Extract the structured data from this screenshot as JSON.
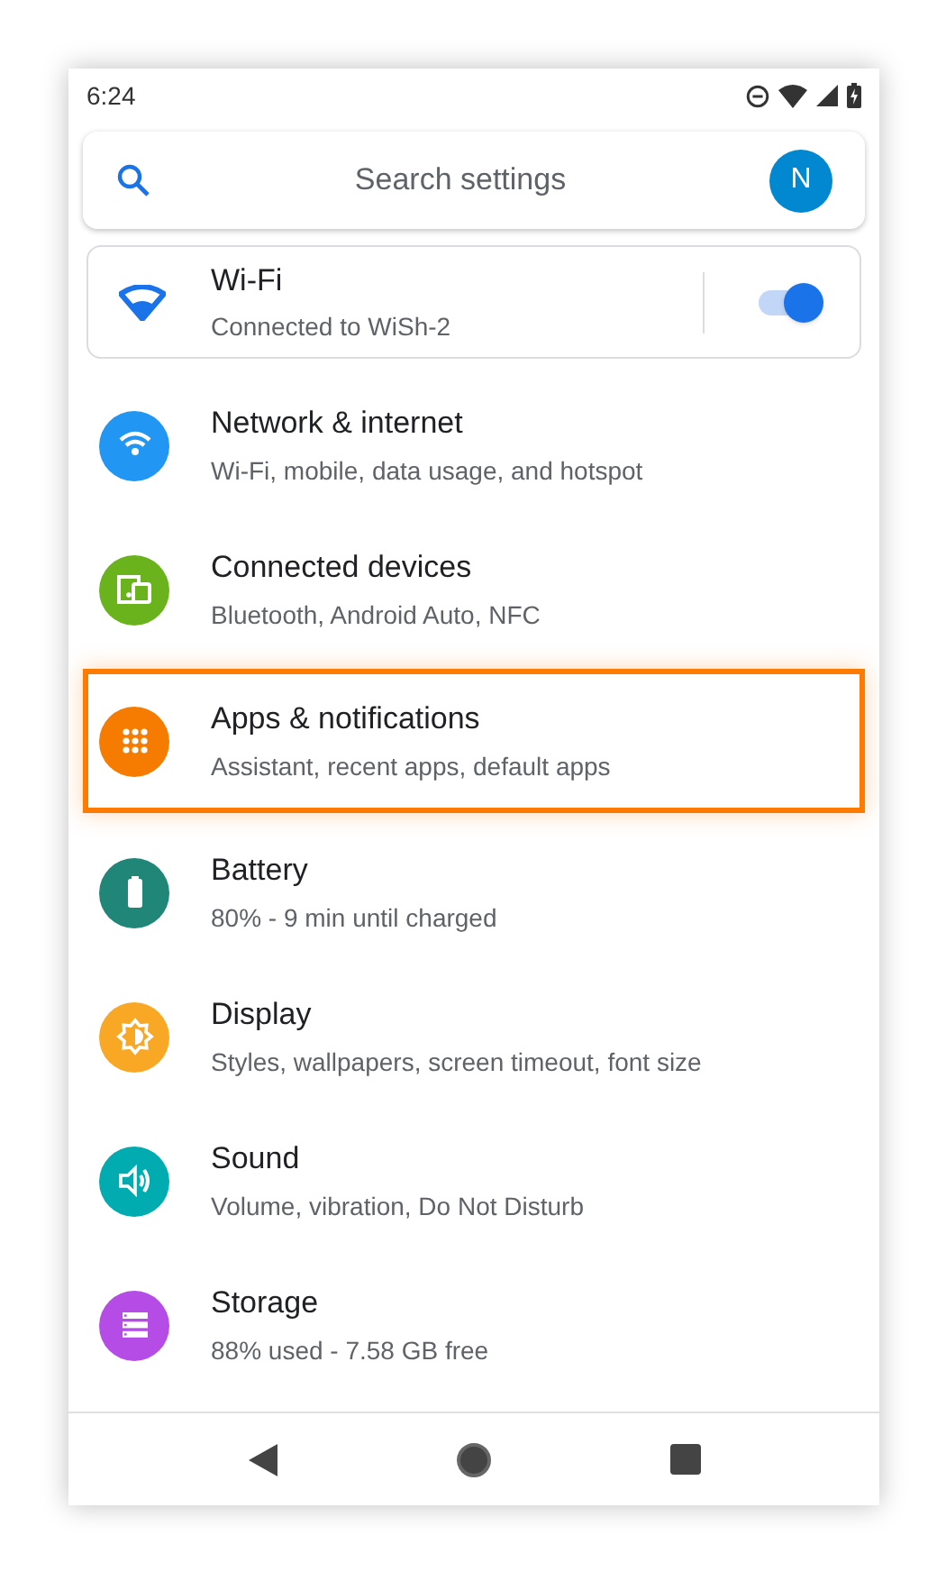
{
  "status_bar": {
    "time": "6:24"
  },
  "search": {
    "placeholder": "Search settings",
    "avatar": "N"
  },
  "wifi_card": {
    "title": "Wi-Fi",
    "subtitle": "Connected to WiSh-2",
    "on": true
  },
  "items": [
    {
      "title": "Network & internet",
      "subtitle": "Wi-Fi, mobile, data usage, and hotspot",
      "color": "#2196f3",
      "selected": false
    },
    {
      "title": "Connected devices",
      "subtitle": "Bluetooth, Android Auto, NFC",
      "color": "#6bb31d",
      "selected": false
    },
    {
      "title": "Apps & notifications",
      "subtitle": "Assistant, recent apps, default apps",
      "color": "#f57c00",
      "selected": true
    },
    {
      "title": "Battery",
      "subtitle": "80% - 9 min until charged",
      "color": "#1f8678",
      "selected": false
    },
    {
      "title": "Display",
      "subtitle": "Styles, wallpapers, screen timeout, font size",
      "color": "#f9a825",
      "selected": false
    },
    {
      "title": "Sound",
      "subtitle": "Volume, vibration, Do Not Disturb",
      "color": "#00acb0",
      "selected": false
    },
    {
      "title": "Storage",
      "subtitle": "88% used - 7.58 GB free",
      "color": "#b64ce6",
      "selected": false
    }
  ]
}
